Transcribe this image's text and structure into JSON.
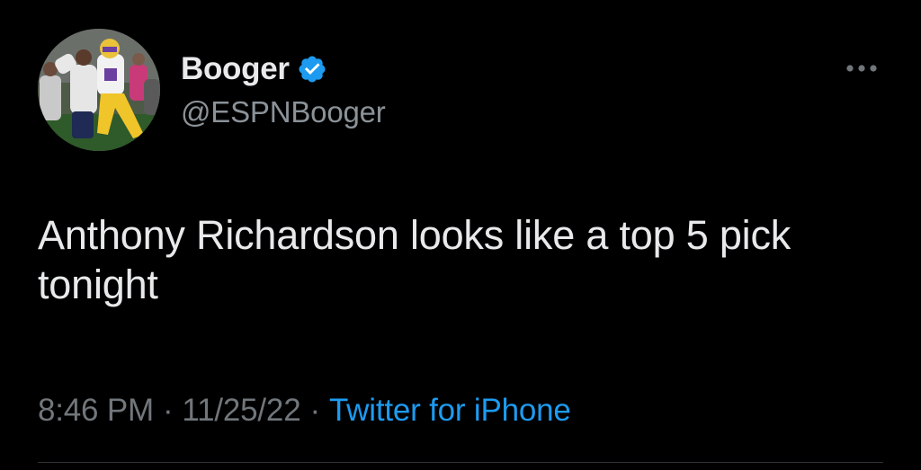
{
  "tweet": {
    "author": {
      "display_name": "Booger",
      "handle": "@ESPNBooger",
      "verified_icon": "verified-badge-icon"
    },
    "more_icon": "more-options-icon",
    "text": "Anthony Richardson looks like a top 5 pick tonight",
    "time": "8:46 PM",
    "separator": "·",
    "date": "11/25/22",
    "source": "Twitter for iPhone"
  },
  "colors": {
    "background": "#000000",
    "primary_text": "#e7e9ea",
    "secondary_text": "#71767b",
    "accent": "#1d9bf0"
  }
}
